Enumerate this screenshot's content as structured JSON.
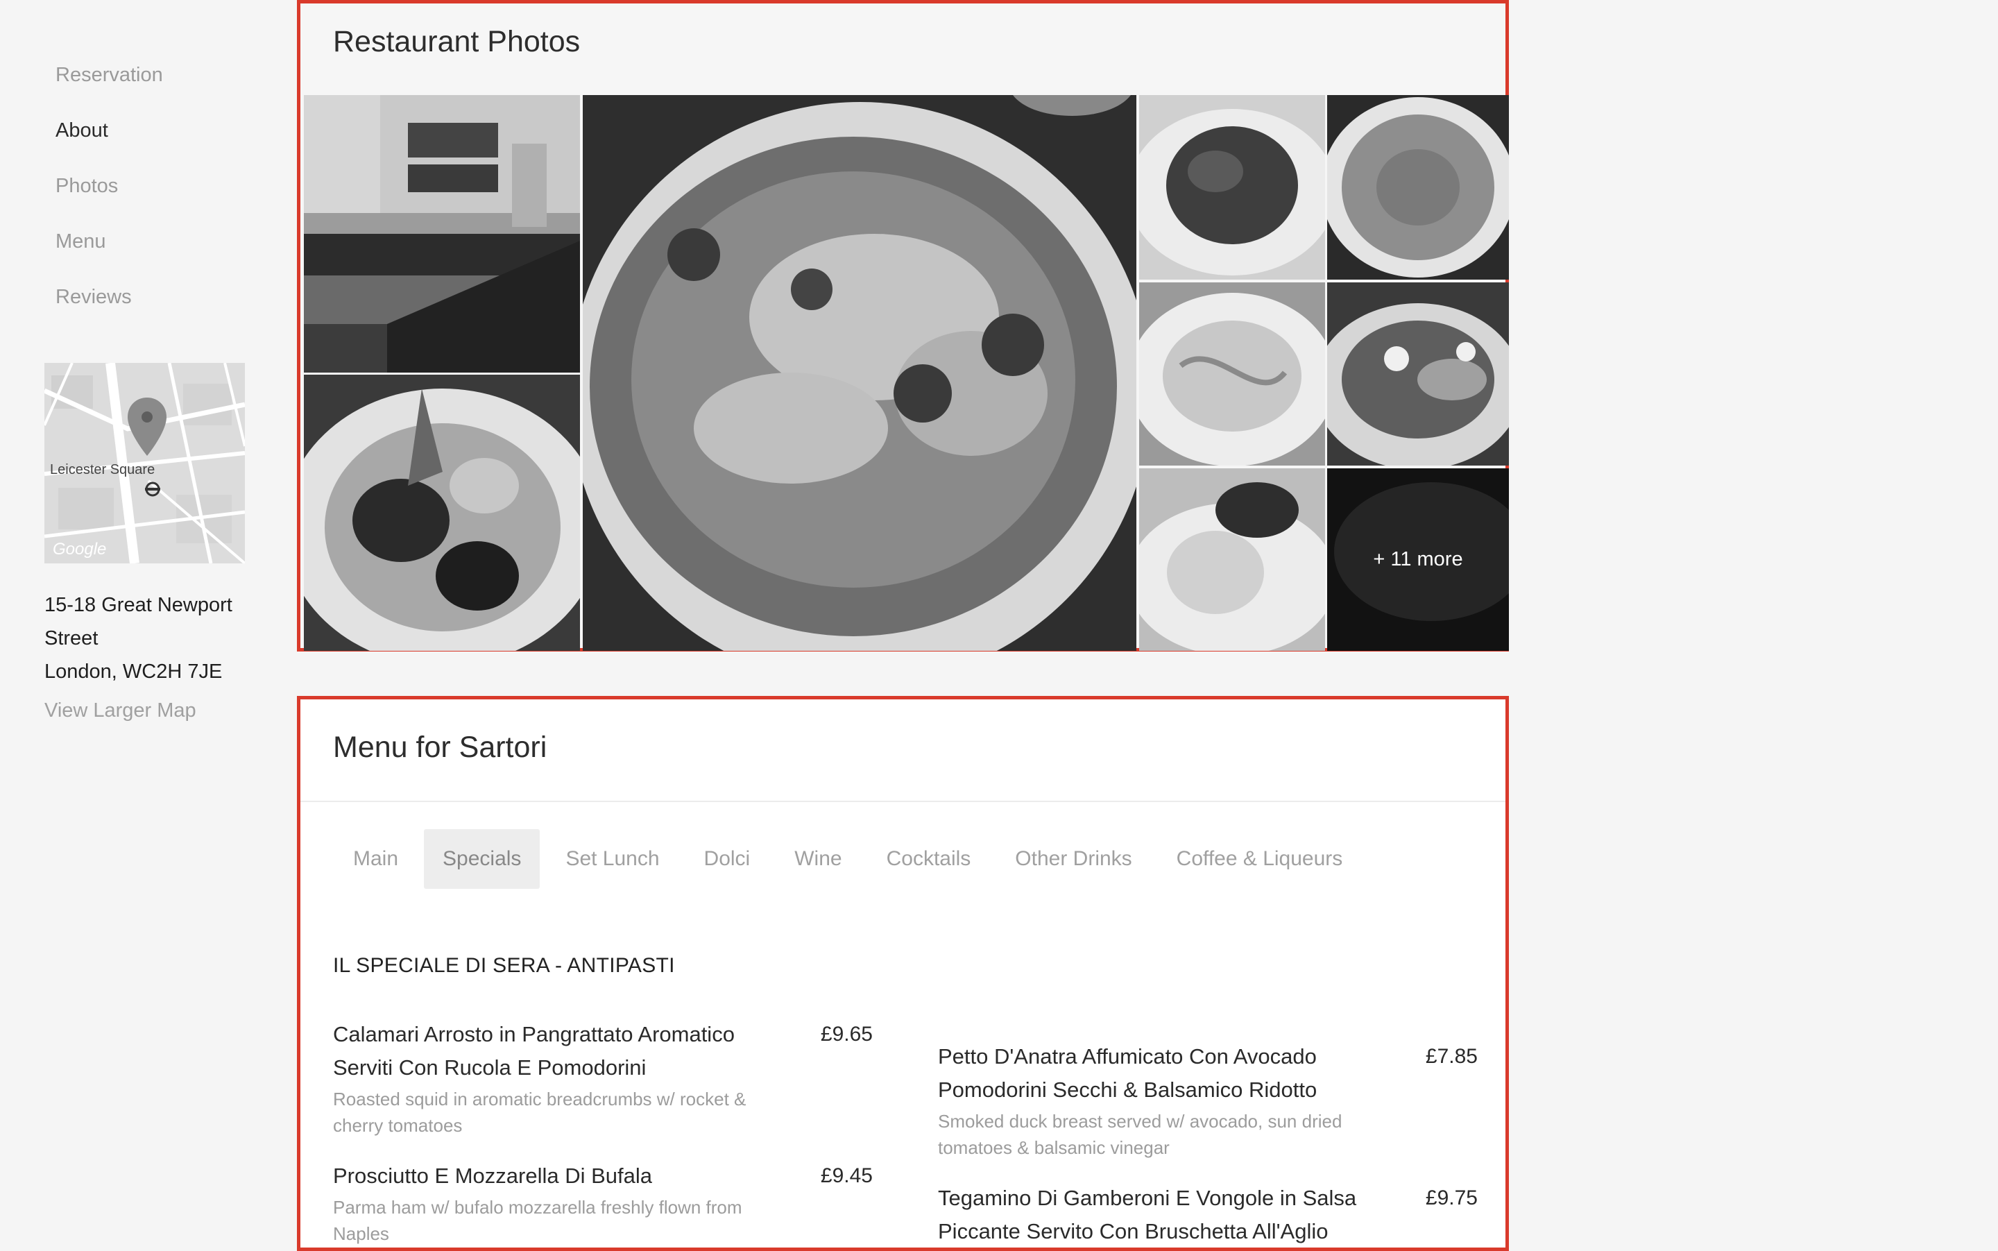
{
  "sidebar": {
    "nav": [
      {
        "label": "Reservation"
      },
      {
        "label": "About"
      },
      {
        "label": "Photos"
      },
      {
        "label": "Menu"
      },
      {
        "label": "Reviews"
      }
    ],
    "map": {
      "place_label": "Leicester Square",
      "brand": "Google"
    },
    "address": {
      "line1": "15-18 Great Newport",
      "line2": "Street",
      "line3": "London, WC2H 7JE"
    },
    "view_map_label": "View Larger Map"
  },
  "photos": {
    "title": "Restaurant Photos",
    "more_label": "+ 11 more"
  },
  "menu": {
    "title": "Menu for Sartori",
    "tabs": [
      {
        "label": "Main"
      },
      {
        "label": "Specials"
      },
      {
        "label": "Set Lunch"
      },
      {
        "label": "Dolci"
      },
      {
        "label": "Wine"
      },
      {
        "label": "Cocktails"
      },
      {
        "label": "Other Drinks"
      },
      {
        "label": "Coffee & Liqueurs"
      }
    ],
    "active_tab": "Specials",
    "section_title": "IL SPECIALE DI SERA - ANTIPASTI",
    "items": [
      {
        "name": "Calamari Arrosto in Pangrattato Aromatico Serviti Con Rucola E Pomodorini",
        "price": "£9.65",
        "description": "Roasted squid in aromatic breadcrumbs w/ rocket & cherry tomatoes"
      },
      {
        "name": "Petto D'Anatra Affumicato Con Avocado Pomodorini Secchi & Balsamico Ridotto",
        "price": "£7.85",
        "description": "Smoked duck breast served w/ avocado, sun dried tomatoes & balsamic vinegar"
      },
      {
        "name": "Prosciutto E Mozzarella Di Bufala",
        "price": "£9.45",
        "description": "Parma ham w/ bufalo mozzarella freshly flown from Naples"
      },
      {
        "name": "Tegamino Di Gamberoni E Vongole in Salsa Piccante Servito Con Bruschetta All'Aglio",
        "price": "£9.75",
        "description": ""
      }
    ]
  },
  "colors": {
    "highlight_border": "#d93a2b",
    "page_background": "#f5f5f5"
  }
}
